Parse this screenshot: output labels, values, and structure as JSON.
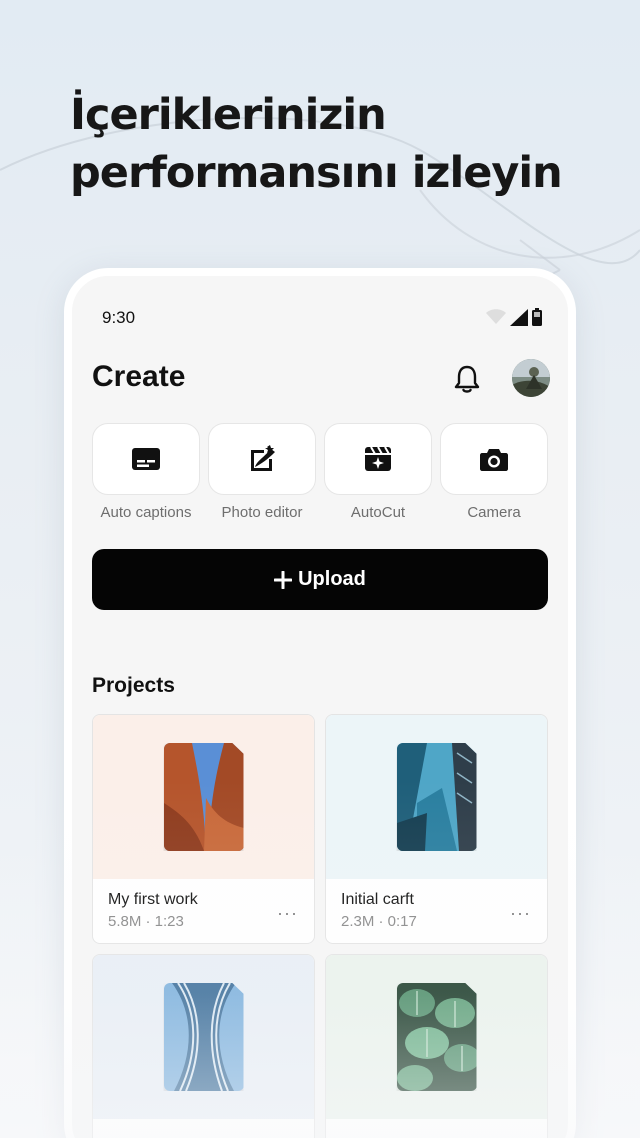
{
  "headline": {
    "line1": "İçeriklerinizin",
    "line2": "performansını izleyin"
  },
  "status_bar": {
    "time": "9:30",
    "icons": [
      "wifi-icon",
      "signal-icon",
      "battery-icon"
    ]
  },
  "header": {
    "title": "Create",
    "bell_icon": "bell-icon",
    "avatar": "avatar"
  },
  "tools": [
    {
      "label": "Auto captions",
      "icon": "captions-icon"
    },
    {
      "label": "Photo editor",
      "icon": "photo-edit-icon"
    },
    {
      "label": "AutoCut",
      "icon": "autocut-icon"
    },
    {
      "label": "Camera",
      "icon": "camera-icon"
    }
  ],
  "upload": {
    "label": "Upload",
    "icon": "plus-icon"
  },
  "projects": {
    "title": "Projects",
    "items": [
      {
        "name": "My first work",
        "meta": "5.8M · 1:23",
        "more": "···",
        "thumb_bg": "#fbefe9"
      },
      {
        "name": "Initial carft",
        "meta": "2.3M · 0:17",
        "more": "···",
        "thumb_bg": "#ecf5f8"
      },
      {
        "thumb_bg": "#e8eef5"
      },
      {
        "thumb_bg": "#eaf2ec"
      }
    ]
  },
  "colors": {
    "upload_bg": "#050505",
    "page_bg": "#e6edf3"
  }
}
